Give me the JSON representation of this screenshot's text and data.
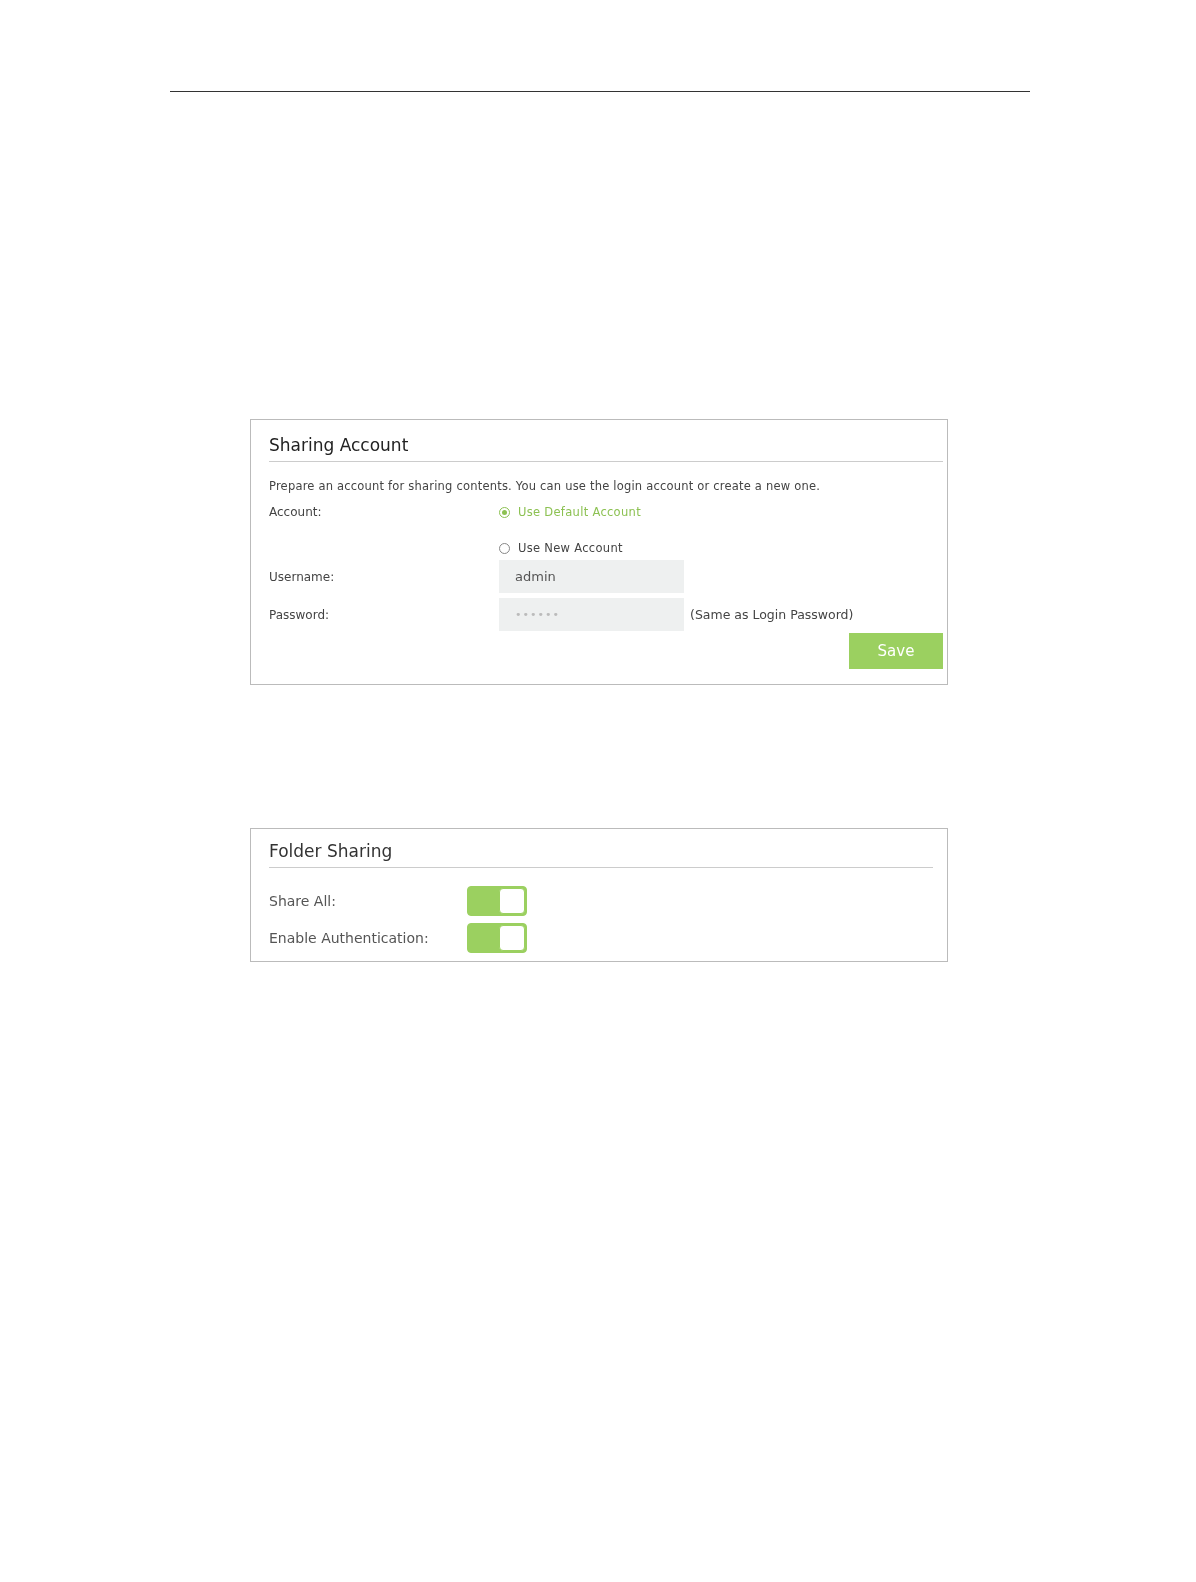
{
  "sharing_account": {
    "title": "Sharing Account",
    "description": "Prepare an account for sharing contents. You can use the login account or create a new one.",
    "account_label": "Account:",
    "account_options": [
      {
        "label": "Use Default Account",
        "selected": true
      },
      {
        "label": "Use New Account",
        "selected": false
      }
    ],
    "username": {
      "label": "Username:",
      "value": "admin"
    },
    "password": {
      "label": "Password:",
      "value": "••••••",
      "note": "(Same as Login Password)"
    },
    "save_button": "Save"
  },
  "folder_sharing": {
    "title": "Folder Sharing",
    "toggles": [
      {
        "label": "Share All:",
        "on": true
      },
      {
        "label": "Enable Authentication:",
        "on": true
      }
    ]
  }
}
